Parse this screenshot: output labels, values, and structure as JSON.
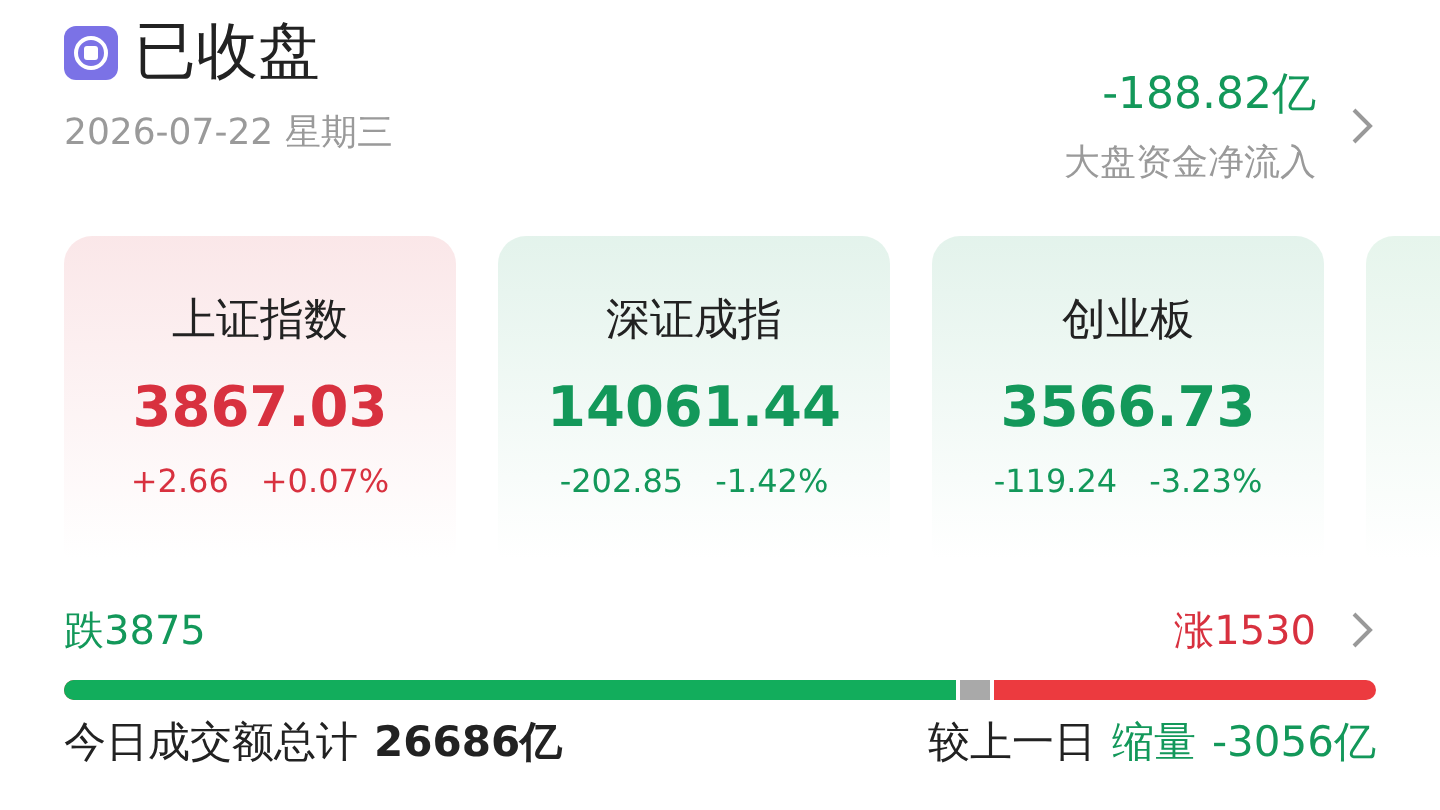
{
  "header": {
    "title": "已收盘",
    "date": "2026-07-22 星期三",
    "net_flow": {
      "value": "-188.82亿",
      "color": "#13985a",
      "label": "大盘资金净流入"
    }
  },
  "indices": [
    {
      "name": "上证指数",
      "value": "3867.03",
      "change": "+2.66",
      "percent": "+0.07%",
      "color": "#d8313f"
    },
    {
      "name": "深证成指",
      "value": "14061.44",
      "change": "-202.85",
      "percent": "-1.42%",
      "color": "#13985a"
    },
    {
      "name": "创业板",
      "value": "3566.73",
      "change": "-119.24",
      "percent": "-3.23%",
      "color": "#13985a"
    }
  ],
  "breadth": {
    "fall": {
      "label": "跌",
      "count": "3875"
    },
    "rise": {
      "label": "涨",
      "count": "1530"
    },
    "bar": {
      "level": 0.683
    }
  },
  "turnover": {
    "label": "今日成交额总计",
    "value": "26686亿",
    "compare_label": "较上一日",
    "change_label": "缩量",
    "change": "-3056亿",
    "color": "#13985a"
  }
}
